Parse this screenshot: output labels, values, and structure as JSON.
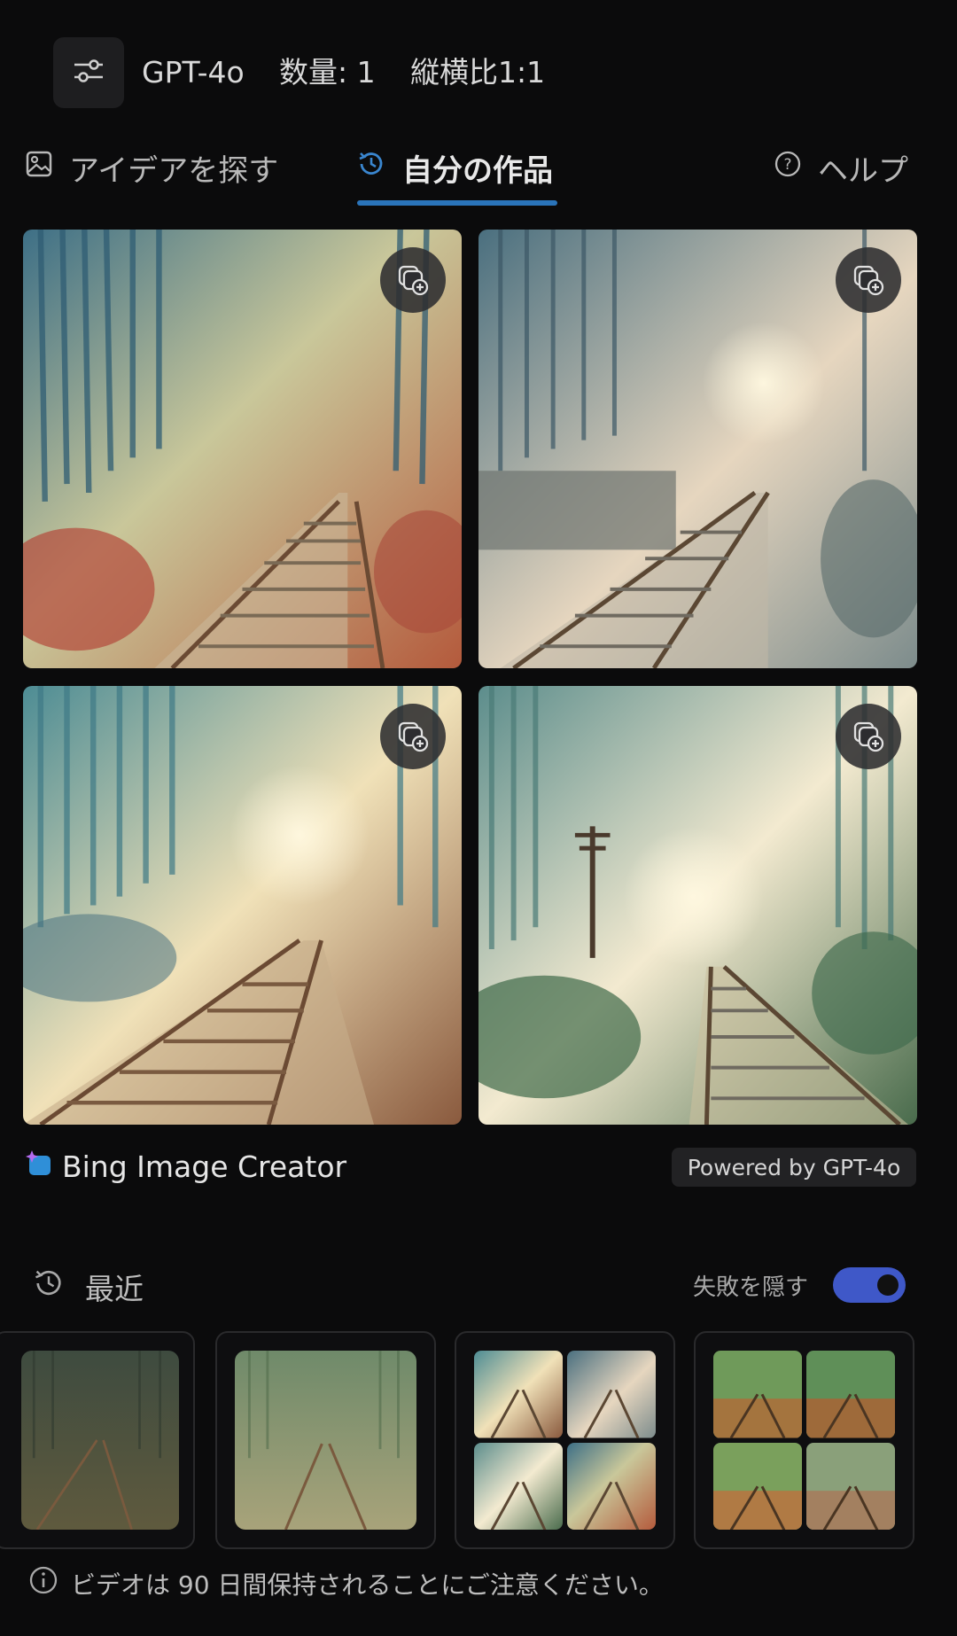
{
  "top_bar": {
    "settings_icon": "sliders-icon",
    "model": "GPT-4o",
    "count": "数量: 1",
    "aspect": "縦横比1:1"
  },
  "tabs": [
    {
      "label": "アイデアを探す",
      "icon": "image-icon"
    },
    {
      "label": "自分の作品",
      "icon": "history-icon"
    },
    {
      "label": "ヘルプ",
      "icon": "help-circle-icon"
    }
  ],
  "images": [
    {
      "icon": "add-to-collection-icon"
    },
    {
      "icon": "add-to-collection-icon"
    },
    {
      "icon": "add-to-collection-icon"
    },
    {
      "icon": "add-to-collection-icon"
    }
  ],
  "branding": {
    "name": "Bing Image Creator",
    "powered_by": "Powered by GPT-4o"
  },
  "recent": {
    "title": "最近",
    "hide_failures": "失敗を隠す",
    "toggle_on": true
  },
  "notice": "ビデオは 90 日間保持されることにご注意ください。",
  "colors": {
    "background": "#0b0b0c",
    "accent": "#2a74ba",
    "toggle": "#3f58c8"
  }
}
